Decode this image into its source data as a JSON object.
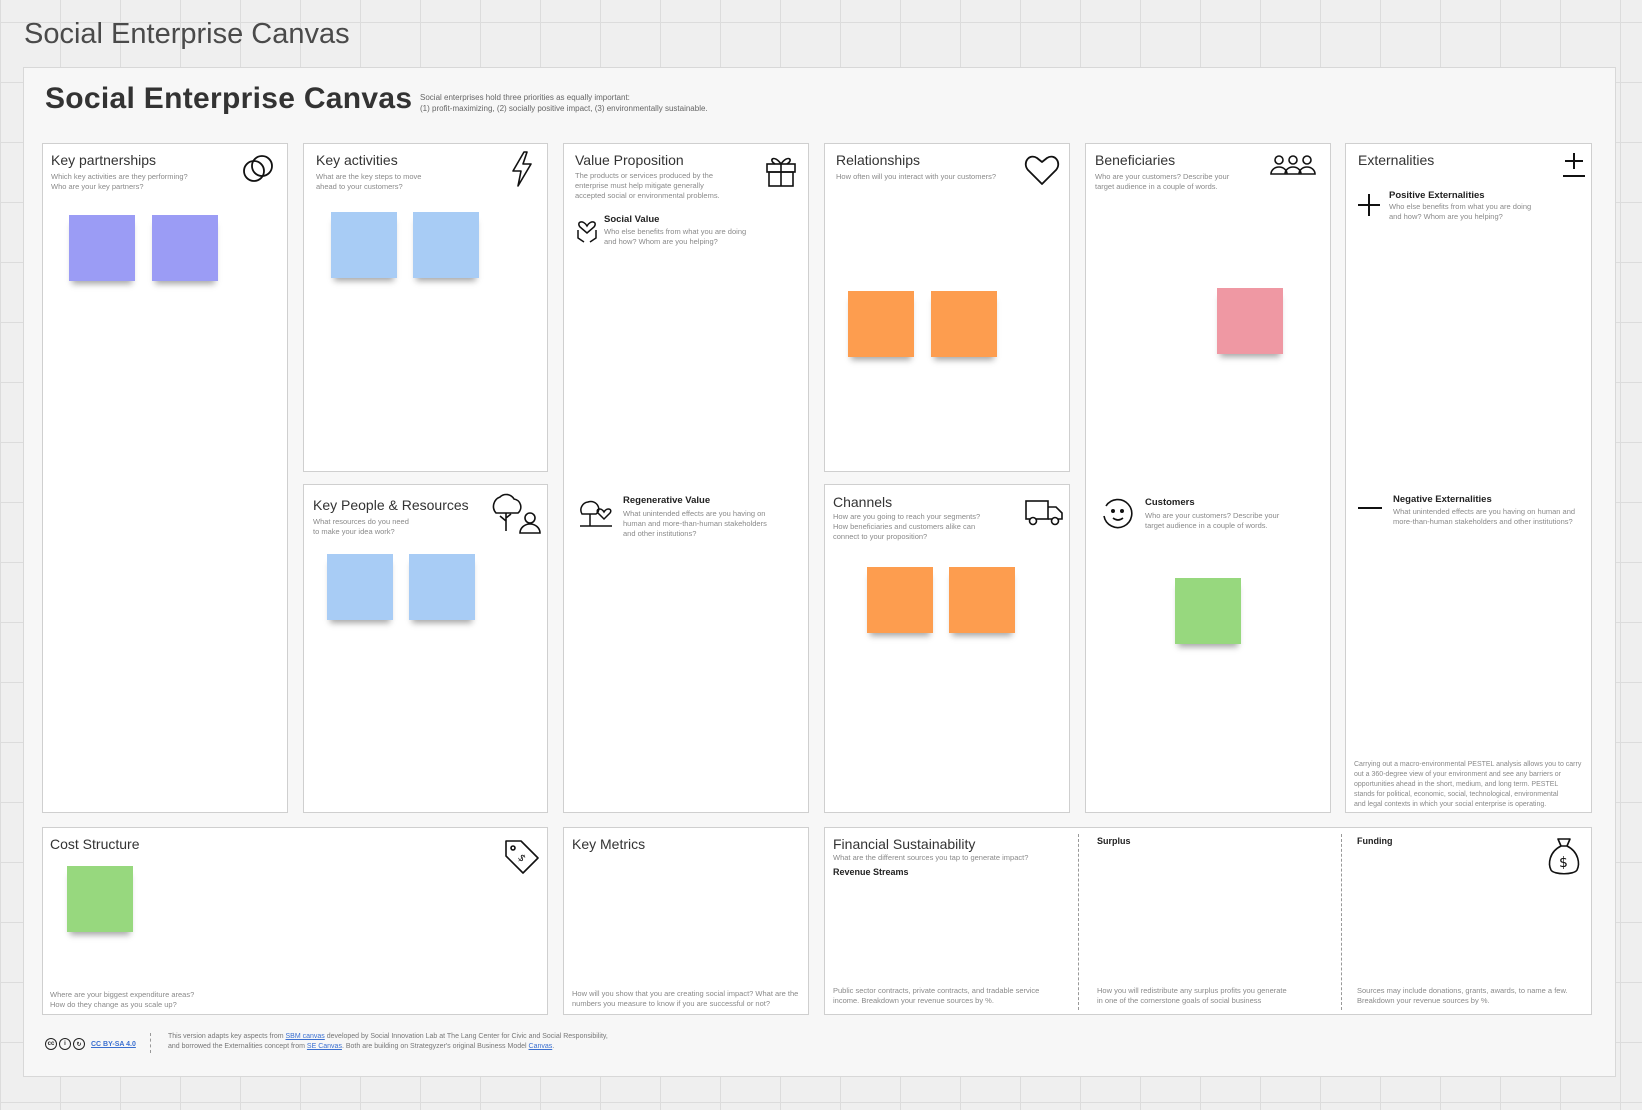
{
  "board": {
    "name": "Social Enterprise Canvas"
  },
  "header": {
    "title": "Social Enterprise Canvas",
    "intro_line1": "Social enterprises hold three priorities as equally important:",
    "intro_line2": "(1) profit-maximizing, (2) socially positive impact, (3) environmentally sustainable."
  },
  "panels": {
    "key_partnerships": {
      "title": "Key partnerships",
      "desc1": "Which key activities are they performing?",
      "desc2": "Who are your key partners?",
      "icon": "link-icon"
    },
    "key_activities": {
      "title": "Key activities",
      "desc1": "What are the key steps to move",
      "desc2": "ahead to your customers?",
      "icon": "lightning-icon"
    },
    "key_people": {
      "title": "Key People & Resources",
      "desc1": "What resources do you need",
      "desc2": "to make your idea work?",
      "icon": "tree-person-icon"
    },
    "value_proposition": {
      "title": "Value Proposition",
      "desc1": "The products or services produced by the",
      "desc2": "enterprise must help mitigate generally",
      "desc3": "accepted social or environmental problems.",
      "icon": "gift-icon",
      "social_value": {
        "title": "Social Value",
        "desc1": "Who else benefits from what you are doing",
        "desc2": "and how? Whom are you helping?",
        "icon": "hand-heart-icon"
      },
      "regenerative_value": {
        "title": "Regenerative Value",
        "desc1": "What unintended effects are you having on",
        "desc2": "human and more-than-human stakeholders",
        "desc3": "and other institutions?",
        "icon": "tree-heart-icon"
      }
    },
    "relationships": {
      "title": "Relationships",
      "desc1": "How often will you interact with your customers?",
      "icon": "heart-icon"
    },
    "channels": {
      "title": "Channels",
      "desc1": "How are you going to reach your segments?",
      "desc2": "How beneficiaries and customers alike can",
      "desc3": "connect to your proposition?",
      "icon": "truck-icon"
    },
    "beneficiaries": {
      "title": "Beneficiaries",
      "desc1": "Who are your customers? Describe your",
      "desc2": "target audience in a couple of words.",
      "icon": "people-icon",
      "customers": {
        "title": "Customers",
        "desc1": "Who are your customers? Describe your",
        "desc2": "target audience in a couple of words.",
        "icon": "face-icon"
      }
    },
    "externalities": {
      "title": "Externalities",
      "icon": "plus-minus-icon",
      "positive": {
        "title": "Positive Externalities",
        "desc1": "Who else benefits from what you are doing",
        "desc2": "and how? Whom are you helping?"
      },
      "negative": {
        "title": "Negative Externalities",
        "desc1": "What unintended effects are you having on human and",
        "desc2": "more-than-human stakeholders and other institutions?"
      },
      "footer1": "Carrying out a macro-environmental PESTEL analysis allows you to carry",
      "footer2": "out a 360-degree view of your environment and see any barriers or",
      "footer3": "opportunities ahead in the short, medium, and long term. PESTEL",
      "footer4": "stands for political, economic, social, technological, environmental",
      "footer5": "and legal contexts in which your social enterprise is operating."
    },
    "cost_structure": {
      "title": "Cost Structure",
      "desc1": "Where are your biggest expenditure areas?",
      "desc2": "How do they change as you scale up?",
      "icon": "price-tag-icon"
    },
    "key_metrics": {
      "title": "Key Metrics",
      "desc1": "How will you show that you are creating social impact? What are the",
      "desc2": "numbers you measure to know if you are successful or not?"
    },
    "financial": {
      "title": "Financial Sustainability",
      "desc1": "What are the different sources you tap to generate impact?",
      "revenue_title": "Revenue Streams",
      "revenue_desc1": "Public sector contracts, private contracts, and tradable service",
      "revenue_desc2": "income. Breakdown your revenue sources by %.",
      "surplus_title": "Surplus",
      "surplus_desc1": "How you will redistribute any surplus profits you generate",
      "surplus_desc2": "in one of the cornerstone goals of social business",
      "funding_title": "Funding",
      "funding_desc1": "Sources may include donations, grants, awards, to name a few.",
      "funding_desc2": "Breakdown your revenue sources by %.",
      "icon": "money-bag-icon"
    }
  },
  "footer": {
    "license": "CC BY-SA 4.0",
    "line1_a": "This version adapts key aspects from",
    "line1_link": "SBM canvas",
    "line1_b": "developed by Social Innovation Lab at The Lang Center for Civic and Social Responsibility,",
    "line2_a": "and borrowed the Externalities concept from",
    "line2_link": "SE Canvas",
    "line2_b": ". Both are building on Strategyzer's original Business Model",
    "line2_link2": "Canvas",
    "line2_end": "."
  },
  "sticky_colors": {
    "purple": "#9b9cf5",
    "blue": "#a8ccf5",
    "orange": "#fd9d4f",
    "pink": "#ef98a3",
    "green": "#97d87e"
  }
}
